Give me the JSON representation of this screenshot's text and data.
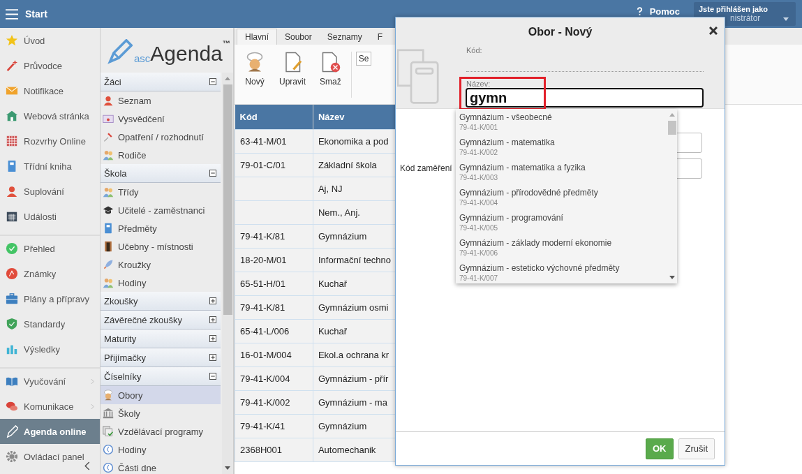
{
  "top_bar": {
    "title": "Start",
    "help_label": "Pomoc",
    "user": {
      "caption": "Jste přihlášen jako",
      "name": "nistrátor"
    }
  },
  "nav": {
    "groups": [
      {
        "items": [
          {
            "label": "Úvod",
            "selected": false,
            "submenu": false
          },
          {
            "label": "Průvodce",
            "selected": false,
            "submenu": false
          },
          {
            "label": "Notifikace",
            "selected": false,
            "submenu": false
          },
          {
            "label": "Webová stránka",
            "selected": false,
            "submenu": false
          },
          {
            "label": "Rozvrhy Online",
            "selected": false,
            "submenu": false
          },
          {
            "label": "Třídní kniha",
            "selected": false,
            "submenu": false
          },
          {
            "label": "Suplování",
            "selected": false,
            "submenu": false
          },
          {
            "label": "Události",
            "selected": false,
            "submenu": false
          }
        ]
      },
      {
        "items": [
          {
            "label": "Přehled",
            "selected": false,
            "submenu": false
          },
          {
            "label": "Známky",
            "selected": false,
            "submenu": false
          },
          {
            "label": "Plány a přípravy",
            "selected": false,
            "submenu": false
          },
          {
            "label": "Standardy",
            "selected": false,
            "submenu": false
          },
          {
            "label": "Výsledky",
            "selected": false,
            "submenu": false
          }
        ]
      },
      {
        "items": [
          {
            "label": "Vyučování",
            "selected": false,
            "submenu": true
          },
          {
            "label": "Komunikace",
            "selected": false,
            "submenu": true
          },
          {
            "label": "Agenda online",
            "selected": true,
            "submenu": false
          },
          {
            "label": "Ovládací panel",
            "selected": false,
            "submenu": false
          }
        ]
      }
    ]
  },
  "panel": {
    "logo": {
      "prefix": "asc",
      "name": "Agenda",
      "mark": "™"
    },
    "sections": [
      {
        "title": "Žáci",
        "expanded": true,
        "items": [
          {
            "label": "Seznam",
            "selected": false
          },
          {
            "label": "Vysvědčení",
            "selected": false
          },
          {
            "label": "Opatření / rozhodnutí",
            "selected": false
          },
          {
            "label": "Rodiče",
            "selected": false
          }
        ]
      },
      {
        "title": "Škola",
        "expanded": true,
        "items": [
          {
            "label": "Třídy",
            "selected": false
          },
          {
            "label": "Učitelé - zaměstnanci",
            "selected": false
          },
          {
            "label": "Předměty",
            "selected": false
          },
          {
            "label": "Učebny - místnosti",
            "selected": false
          },
          {
            "label": "Kroužky",
            "selected": false
          },
          {
            "label": "Hodiny",
            "selected": false
          }
        ]
      },
      {
        "title": "Zkoušky",
        "expanded": false
      },
      {
        "title": "Závěrečné zkoušky",
        "expanded": false
      },
      {
        "title": "Maturity",
        "expanded": false
      },
      {
        "title": "Přijímačky",
        "expanded": false
      },
      {
        "title": "Číselníky",
        "expanded": true,
        "items": [
          {
            "label": "Obory",
            "selected": true
          },
          {
            "label": "Školy",
            "selected": false
          },
          {
            "label": "Vzdělávací programy",
            "selected": false
          },
          {
            "label": "Hodiny",
            "selected": false
          },
          {
            "label": "Části dne",
            "selected": false
          }
        ]
      }
    ]
  },
  "ribbon": {
    "tabs": [
      {
        "label": "Hlavní",
        "selected": true
      },
      {
        "label": "Soubor",
        "selected": false
      },
      {
        "label": "Seznamy",
        "selected": false
      },
      {
        "label": "F",
        "selected": false
      }
    ],
    "buttons": [
      {
        "label": "Nový"
      },
      {
        "label": "Upravit"
      },
      {
        "label": "Smaž"
      }
    ],
    "select_value": "Se"
  },
  "table": {
    "columns": [
      "Kód",
      "Název"
    ],
    "rows": [
      {
        "code": "63-41-M/01",
        "name": "Ekonomika a pod"
      },
      {
        "code": "79-01-C/01",
        "name": "Základní škola"
      },
      {
        "code": "",
        "name": "Aj, NJ"
      },
      {
        "code": "",
        "name": "Nem., Anj."
      },
      {
        "code": "79-41-K/81",
        "name": "Gymnázium"
      },
      {
        "code": "18-20-M/01",
        "name": "Informační techno"
      },
      {
        "code": "65-51-H/01",
        "name": "Kuchař"
      },
      {
        "code": "79-41-K/81",
        "name": "Gymnázium osmi"
      },
      {
        "code": "65-41-L/006",
        "name": "Kuchař"
      },
      {
        "code": "16-01-M/004",
        "name": "Ekol.a ochrana kr"
      },
      {
        "code": "79-41-K/004",
        "name": "Gymnázium - přír"
      },
      {
        "code": "79-41-K/002",
        "name": "Gymnázium - ma"
      },
      {
        "code": "79-41-K/41",
        "name": "Gymnázium"
      },
      {
        "code": "2368H001",
        "name": "Automechanik"
      }
    ]
  },
  "dialog": {
    "title": "Obor - Nový",
    "code_label": "Kód:",
    "name_field": {
      "label": "Název:",
      "value": "gymn",
      "highlighted": true
    },
    "focus_label": "Kód zaměření",
    "suggestions": [
      {
        "name": "Gymnázium - všeobecné",
        "code": "79-41-K/001"
      },
      {
        "name": "Gymnázium - matematika",
        "code": "79-41-K/002"
      },
      {
        "name": "Gymnázium - matematika a fyzika",
        "code": "79-41-K/003"
      },
      {
        "name": "Gymnázium - přírodovědné předměty",
        "code": "79-41-K/004"
      },
      {
        "name": "Gymnázium - programování",
        "code": "79-41-K/005"
      },
      {
        "name": "Gymnázium - základy moderní ekonomie",
        "code": "79-41-K/006"
      },
      {
        "name": "Gymnázium - esteticko výchovné předměty",
        "code": "79-41-K/007"
      }
    ],
    "buttons": [
      {
        "label": "OK",
        "kind": "primary"
      },
      {
        "label": "Zrušit",
        "kind": "secondary"
      }
    ]
  }
}
